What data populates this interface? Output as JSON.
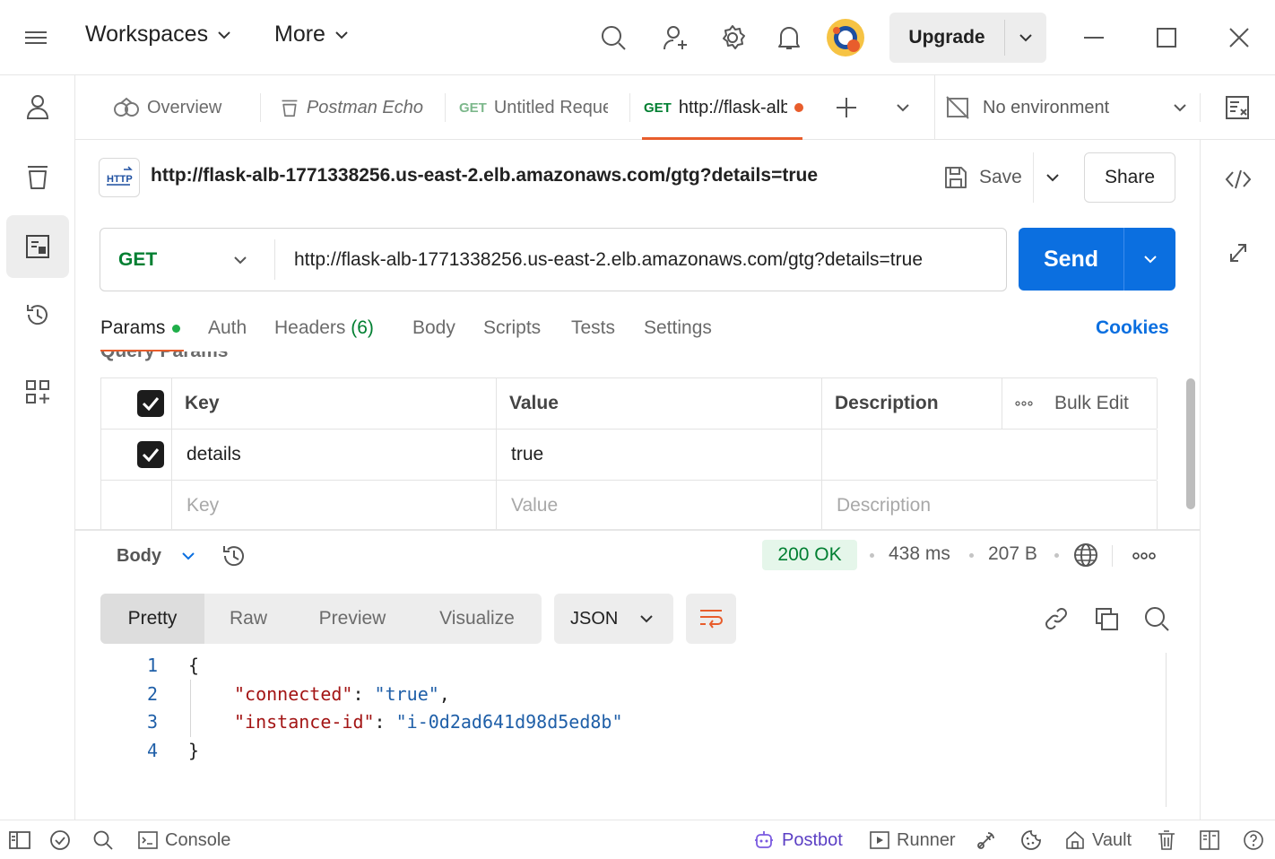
{
  "titlebar": {
    "workspaces_label": "Workspaces",
    "more_label": "More",
    "upgrade_label": "Upgrade"
  },
  "tabs": [
    {
      "method": "",
      "label": "Overview",
      "italic": false
    },
    {
      "method": "",
      "label": "Postman Echo",
      "italic": true
    },
    {
      "method": "GET",
      "label": "Untitled Request",
      "italic": false
    },
    {
      "method": "GET",
      "label": "http://flask-alb",
      "italic": false,
      "active": true,
      "unsaved": true
    }
  ],
  "environment": {
    "label": "No environment"
  },
  "request": {
    "title": "http://flask-alb-1771338256.us-east-2.elb.amazonaws.com/gtg?details=true",
    "save_label": "Save",
    "share_label": "Share",
    "method": "GET",
    "url": "http://flask-alb-1771338256.us-east-2.elb.amazonaws.com/gtg?details=true",
    "send_label": "Send"
  },
  "subtabs": {
    "params": "Params",
    "auth": "Auth",
    "headers": "Headers",
    "headers_count": "(6)",
    "body": "Body",
    "scripts": "Scripts",
    "tests": "Tests",
    "settings": "Settings",
    "cookies": "Cookies"
  },
  "query_params": {
    "section_title": "Query Params",
    "columns": {
      "key": "Key",
      "value": "Value",
      "description": "Description",
      "bulk_edit": "Bulk Edit"
    },
    "rows": [
      {
        "checked": true,
        "key": "details",
        "value": "true",
        "description": ""
      }
    ],
    "placeholder": {
      "key": "Key",
      "value": "Value",
      "description": "Description"
    }
  },
  "response": {
    "section_label": "Body",
    "status": "200 OK",
    "time": "438 ms",
    "size": "207 B",
    "view_tabs": [
      "Pretty",
      "Raw",
      "Preview",
      "Visualize"
    ],
    "active_view": "Pretty",
    "format": "JSON",
    "code_lines": [
      {
        "n": "1",
        "text": "{"
      },
      {
        "n": "2",
        "key": "\"connected\"",
        "value": "\"true\"",
        "trail": ","
      },
      {
        "n": "3",
        "key": "\"instance-id\"",
        "value": "\"i-0d2ad641d98d5ed8b\"",
        "trail": ""
      },
      {
        "n": "4",
        "text": "}"
      }
    ]
  },
  "statusbar": {
    "console": "Console",
    "postbot": "Postbot",
    "runner": "Runner",
    "vault": "Vault"
  },
  "colors": {
    "accent": "#0b6fe0",
    "orange": "#e85d2c",
    "green_status": "#007f31",
    "status_bg": "#e5f6ea",
    "method_get": "#007f31",
    "json_key": "#a31515",
    "json_value": "#1f5fa8"
  }
}
